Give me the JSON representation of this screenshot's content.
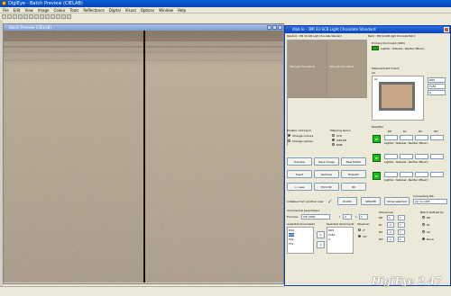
{
  "app": {
    "title": "DigiEye - Batch Preview (CIELAB)"
  },
  "menu": [
    "File",
    "Edit",
    "View",
    "Image",
    "Colour",
    "Tools",
    "Reflectance",
    "Digital",
    "Visual",
    "Options",
    "Window",
    "Help"
  ],
  "subwindow": {
    "title": "Batch Preview (CIELAB)"
  },
  "dialog": {
    "title": "dlab lo - 3MI 32-SCB Light Chocolate Standard",
    "standard_label": "Standard : 3MI 32-SCB Light Chocolate Standard",
    "batch_label": "Batch : 3MI 32-SCB Light Chocolate Batch",
    "swatch_left_text": "3MI Light Chocolate St",
    "swatch_right_text": "3MI Light Chocolate B",
    "primary_illuminant_label": "Primary Illuminant (D65)",
    "primary_illuminant_value": "Lighter, Yellower, Redder (Bluer)",
    "measurement_check_label": "Measurement Check",
    "measurement_check_sub": "All",
    "measure_list": [
      "D65",
      "TL84",
      "A"
    ],
    "dl_header": [
      "DE",
      "DL",
      "DC",
      "DH"
    ],
    "passfail_label": "Pass/Fail",
    "pass_rows": [
      {
        "value": "Lighter, Yellower, Redder (Bluer)"
      },
      {
        "value": "Lighter, Yellower, Redder (Bluer)"
      },
      {
        "value": "Lighter, Yellower, Redder (Bluer)"
      }
    ],
    "pass_badges": [
      "PF",
      "PF",
      "PF"
    ],
    "disable_clicking_label": "Disable clicking to",
    "radio_change_colours": "Change colours",
    "radio_change_names": "Change names",
    "mapping_space_label": "Mapping space",
    "radio_xyz": "XYZ",
    "radio_cielab": "CIELAB",
    "radio_rgb": "RGB",
    "buttons_row1": [
      "Preview",
      "Save image",
      "New Match"
    ],
    "buttons_row2": [
      "Insert",
      "Remove",
      "Hide/QC"
    ],
    "buttons_row3": [
      "<- Less",
      "Print QC",
      "OK"
    ],
    "initialise_label": "Initialise from another user",
    "btn_bstd": "B-STD",
    "btn_update": "UPDATE",
    "btn_show_selected": "Show selected",
    "connecting_file_label": "Connecting file",
    "connecting_file_value": "22 mo D65",
    "commercial_params_label": "Commercial parameters",
    "formula_label": "Formula",
    "formula_value": "CIE 2000",
    "l_label": "l",
    "l_value": "2",
    "c_label": "c",
    "c_value": "1",
    "available_illuminants_label": "Available illuminants",
    "selected_illuminants_label": "Selected illuminants",
    "available_illuminants": [
      "D50",
      "D65",
      "F02",
      "F11"
    ],
    "selected_illuminants": [
      "D65",
      "TL84",
      "A"
    ],
    "observer_label": "Observer",
    "observer_2": "2°",
    "observer_10": "10°",
    "tolerances_label": "Tolerances",
    "tol_rows": [
      {
        "name": "DE",
        "minus": "1",
        "plus": "1"
      },
      {
        "name": "DL",
        "minus": "-1",
        "plus": "1"
      },
      {
        "name": "DC",
        "minus": "-1",
        "plus": "1"
      },
      {
        "name": "DH",
        "minus": "-1",
        "plus": "1"
      }
    ],
    "batch_defined_by_label": "Batch Defined by",
    "batch_radio": [
      "DE",
      "DL",
      "All",
      "None"
    ]
  },
  "brand": "DigiEye 2.47"
}
